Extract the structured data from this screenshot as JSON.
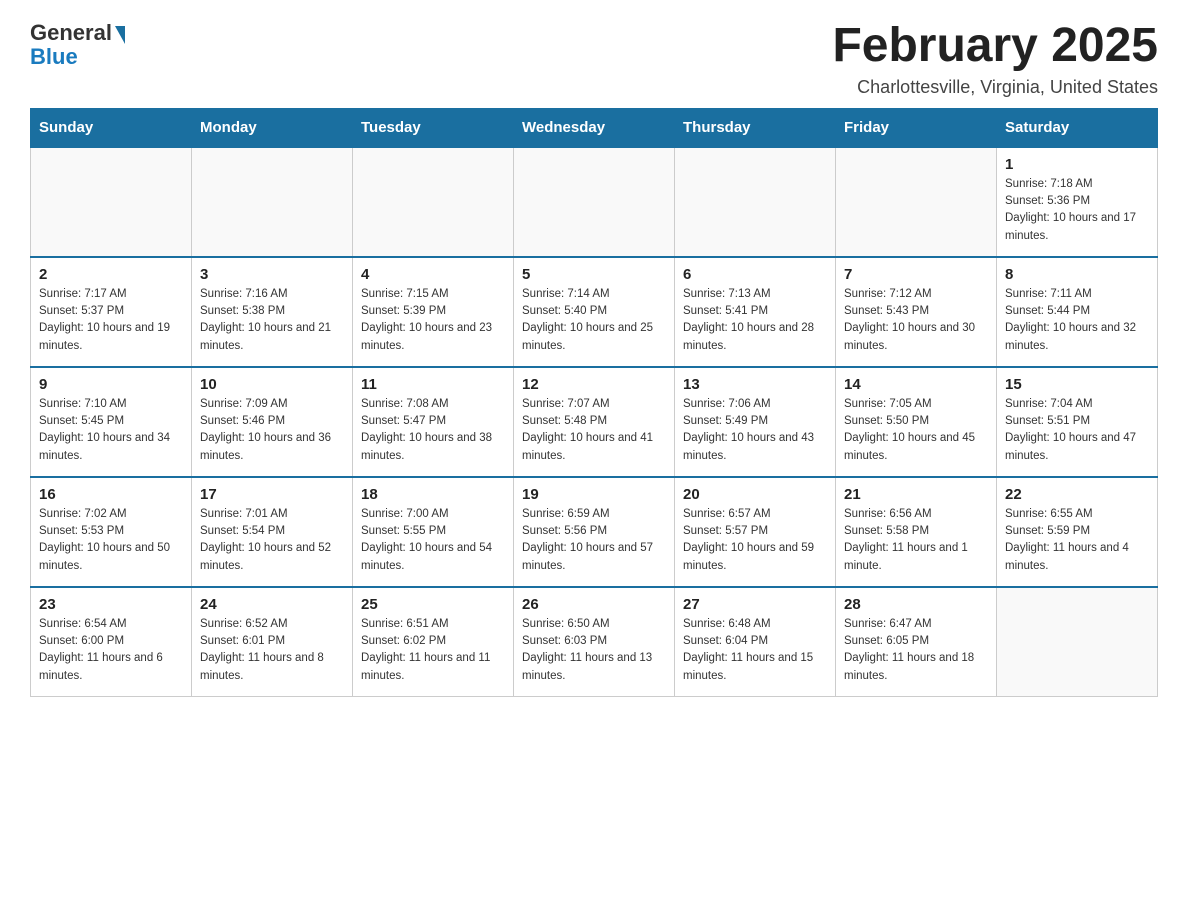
{
  "header": {
    "logo_general": "General",
    "logo_blue": "Blue",
    "month_title": "February 2025",
    "location": "Charlottesville, Virginia, United States"
  },
  "weekdays": [
    "Sunday",
    "Monday",
    "Tuesday",
    "Wednesday",
    "Thursday",
    "Friday",
    "Saturday"
  ],
  "weeks": [
    [
      {
        "day": "",
        "info": ""
      },
      {
        "day": "",
        "info": ""
      },
      {
        "day": "",
        "info": ""
      },
      {
        "day": "",
        "info": ""
      },
      {
        "day": "",
        "info": ""
      },
      {
        "day": "",
        "info": ""
      },
      {
        "day": "1",
        "info": "Sunrise: 7:18 AM\nSunset: 5:36 PM\nDaylight: 10 hours and 17 minutes."
      }
    ],
    [
      {
        "day": "2",
        "info": "Sunrise: 7:17 AM\nSunset: 5:37 PM\nDaylight: 10 hours and 19 minutes."
      },
      {
        "day": "3",
        "info": "Sunrise: 7:16 AM\nSunset: 5:38 PM\nDaylight: 10 hours and 21 minutes."
      },
      {
        "day": "4",
        "info": "Sunrise: 7:15 AM\nSunset: 5:39 PM\nDaylight: 10 hours and 23 minutes."
      },
      {
        "day": "5",
        "info": "Sunrise: 7:14 AM\nSunset: 5:40 PM\nDaylight: 10 hours and 25 minutes."
      },
      {
        "day": "6",
        "info": "Sunrise: 7:13 AM\nSunset: 5:41 PM\nDaylight: 10 hours and 28 minutes."
      },
      {
        "day": "7",
        "info": "Sunrise: 7:12 AM\nSunset: 5:43 PM\nDaylight: 10 hours and 30 minutes."
      },
      {
        "day": "8",
        "info": "Sunrise: 7:11 AM\nSunset: 5:44 PM\nDaylight: 10 hours and 32 minutes."
      }
    ],
    [
      {
        "day": "9",
        "info": "Sunrise: 7:10 AM\nSunset: 5:45 PM\nDaylight: 10 hours and 34 minutes."
      },
      {
        "day": "10",
        "info": "Sunrise: 7:09 AM\nSunset: 5:46 PM\nDaylight: 10 hours and 36 minutes."
      },
      {
        "day": "11",
        "info": "Sunrise: 7:08 AM\nSunset: 5:47 PM\nDaylight: 10 hours and 38 minutes."
      },
      {
        "day": "12",
        "info": "Sunrise: 7:07 AM\nSunset: 5:48 PM\nDaylight: 10 hours and 41 minutes."
      },
      {
        "day": "13",
        "info": "Sunrise: 7:06 AM\nSunset: 5:49 PM\nDaylight: 10 hours and 43 minutes."
      },
      {
        "day": "14",
        "info": "Sunrise: 7:05 AM\nSunset: 5:50 PM\nDaylight: 10 hours and 45 minutes."
      },
      {
        "day": "15",
        "info": "Sunrise: 7:04 AM\nSunset: 5:51 PM\nDaylight: 10 hours and 47 minutes."
      }
    ],
    [
      {
        "day": "16",
        "info": "Sunrise: 7:02 AM\nSunset: 5:53 PM\nDaylight: 10 hours and 50 minutes."
      },
      {
        "day": "17",
        "info": "Sunrise: 7:01 AM\nSunset: 5:54 PM\nDaylight: 10 hours and 52 minutes."
      },
      {
        "day": "18",
        "info": "Sunrise: 7:00 AM\nSunset: 5:55 PM\nDaylight: 10 hours and 54 minutes."
      },
      {
        "day": "19",
        "info": "Sunrise: 6:59 AM\nSunset: 5:56 PM\nDaylight: 10 hours and 57 minutes."
      },
      {
        "day": "20",
        "info": "Sunrise: 6:57 AM\nSunset: 5:57 PM\nDaylight: 10 hours and 59 minutes."
      },
      {
        "day": "21",
        "info": "Sunrise: 6:56 AM\nSunset: 5:58 PM\nDaylight: 11 hours and 1 minute."
      },
      {
        "day": "22",
        "info": "Sunrise: 6:55 AM\nSunset: 5:59 PM\nDaylight: 11 hours and 4 minutes."
      }
    ],
    [
      {
        "day": "23",
        "info": "Sunrise: 6:54 AM\nSunset: 6:00 PM\nDaylight: 11 hours and 6 minutes."
      },
      {
        "day": "24",
        "info": "Sunrise: 6:52 AM\nSunset: 6:01 PM\nDaylight: 11 hours and 8 minutes."
      },
      {
        "day": "25",
        "info": "Sunrise: 6:51 AM\nSunset: 6:02 PM\nDaylight: 11 hours and 11 minutes."
      },
      {
        "day": "26",
        "info": "Sunrise: 6:50 AM\nSunset: 6:03 PM\nDaylight: 11 hours and 13 minutes."
      },
      {
        "day": "27",
        "info": "Sunrise: 6:48 AM\nSunset: 6:04 PM\nDaylight: 11 hours and 15 minutes."
      },
      {
        "day": "28",
        "info": "Sunrise: 6:47 AM\nSunset: 6:05 PM\nDaylight: 11 hours and 18 minutes."
      },
      {
        "day": "",
        "info": ""
      }
    ]
  ]
}
